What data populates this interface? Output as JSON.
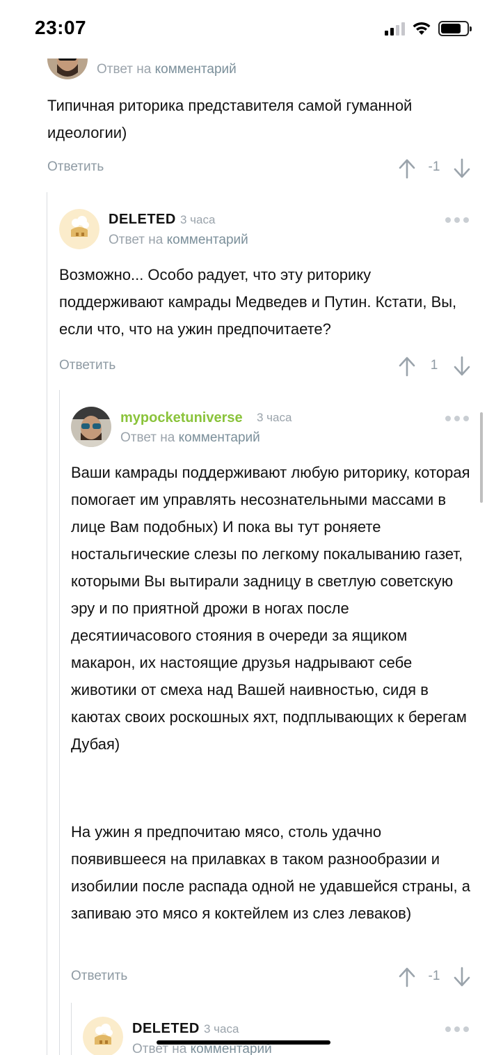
{
  "status_bar": {
    "time": "23:07"
  },
  "comments": [
    {
      "id": "c1",
      "author": "",
      "time": "",
      "reply_prefix": "Ответ на",
      "reply_link": "комментарий",
      "text": "Типичная риторика представителя самой гуманной идеологии)",
      "reply_action": "Ответить",
      "rating": "-1"
    },
    {
      "id": "c2",
      "author": "DELETED",
      "time": "3 часа",
      "reply_prefix": "Ответ на",
      "reply_link": "комментарий",
      "text": "Возможно... Особо радует, что эту риторику поддерживают камрады Медведев и Путин. Кстати, Вы, если что, что на ужин предпочитаете?",
      "reply_action": "Ответить",
      "rating": "1"
    },
    {
      "id": "c3",
      "author": "mypocketuniverse",
      "time": "3 часа",
      "reply_prefix": "Ответ на",
      "reply_link": "комментарий",
      "text_p1": "Ваши камрады поддерживают любую риторику, которая помогает им управлять несознательными массами в лице Вам подобных) И пока вы тут роняете ностальгические слезы по легкому покалыванию газет, которыми Вы вытирали задницу в светлую советскую эру и по приятной дрожи в ногах после десятиичасового стояния в очереди за ящиком макарон, их настоящие друзья надрывают себе животики от смеха над Вашей наивностью, сидя в каютах своих роскошных яхт, подплывающих к берегам Дубая)",
      "text_p2": "На ужин я предпочитаю мясо, столь удачно появившееся на прилавках в таком разнообразии и изобилии после распада одной не удавшейся страны, а запиваю это мясо я коктейлем из слез леваков)",
      "reply_action": "Ответить",
      "rating": "-1"
    },
    {
      "id": "c4",
      "author": "DELETED",
      "time": "3 часа",
      "reply_prefix": "Ответ на",
      "reply_link": "комментарий"
    }
  ],
  "icons": {
    "upvote": "arrow-up-icon",
    "downvote": "arrow-down-icon",
    "more": "more-dots-icon",
    "cellular": "cellular-signal-icon",
    "wifi": "wifi-icon",
    "battery": "battery-icon"
  },
  "colors": {
    "username_green": "#8ac33b",
    "muted": "#9aa3ab",
    "thread_line": "#d9dde0"
  }
}
